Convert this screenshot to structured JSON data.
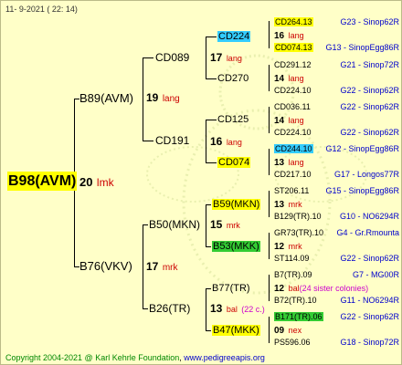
{
  "header": {
    "date": "11-  9-2021 (  22:  14)"
  },
  "footer": {
    "copyright": "Copyright 2004-2021 @ Karl Kehrle Foundation",
    "url": "www.pedigreeapis.org"
  },
  "root": {
    "name": "B98(AVM)",
    "gen": "20",
    "suffix": "lmk"
  },
  "gen1": [
    {
      "name": "B89(AVM)",
      "gen": "19",
      "suffix": "lang"
    },
    {
      "name": "B76(VKV)",
      "gen": "17",
      "suffix": "mrk"
    }
  ],
  "gen2": [
    {
      "name": "CD089",
      "gen": "17",
      "suffix": "lang"
    },
    {
      "name": "CD191",
      "gen": "16",
      "suffix": "lang"
    },
    {
      "name": "B50(MKN)",
      "gen": "15",
      "suffix": "mrk"
    },
    {
      "name": "B26(TR)",
      "gen": "13",
      "suffix": "bal",
      "extra": "(22 c.)"
    }
  ],
  "gen3": [
    {
      "name": "CD224"
    },
    {
      "name": "CD270"
    },
    {
      "name": "CD125"
    },
    {
      "name": "CD074"
    },
    {
      "name": "B59(MKN)"
    },
    {
      "name": "B53(MKK)"
    },
    {
      "name": "B77(TR)"
    },
    {
      "name": "B47(MKK)"
    }
  ],
  "gen4": [
    {
      "name": "CD264.13",
      "code": "G23 - Sinop62R",
      "gen": "16",
      "suffix": "lang",
      "mother": "CD074.13",
      "mcode": "G13 - SinopEgg86R"
    },
    {
      "name": "CD291.12",
      "code": "G21 - Sinop72R",
      "gen": "14",
      "suffix": "lang",
      "mother": "CD224.10",
      "mcode": "G22 - Sinop62R"
    },
    {
      "name": "CD036.11",
      "code": "G22 - Sinop62R",
      "gen": "14",
      "suffix": "lang",
      "mother": "CD224.10",
      "mcode": "G22 - Sinop62R"
    },
    {
      "name": "CD244.10",
      "code": "G12 - SinopEgg86R",
      "gen": "13",
      "suffix": "lang",
      "mother": "CD217.10",
      "mcode": "G17 - Longos77R"
    },
    {
      "name": "ST206.11",
      "code": "G15 - SinopEgg86R",
      "gen": "13",
      "suffix": "mrk",
      "mother": "B129(TR).10",
      "mcode": "G10 - NO6294R"
    },
    {
      "name": "GR73(TR).10",
      "code": "G4 - Gr.Rmounta",
      "gen": "12",
      "suffix": "mrk",
      "mother": "ST114.09",
      "mcode": "G22 - Sinop62R"
    },
    {
      "name": "B7(TR).09",
      "code": "G7 - MG00R",
      "gen": "12",
      "suffix": "bal",
      "extra": "(24 sister colonies)",
      "mother": "B72(TR).10",
      "mcode": "G11 - NO6294R"
    },
    {
      "name": "B171(TR).06",
      "code": "G22 - Sinop62R",
      "gen": "09",
      "suffix": "nex",
      "mother": "PS596.06",
      "mcode": "G18 - Sinop72R"
    }
  ],
  "colors": {
    "background": "#ffffc8",
    "highlight_yellow": "#ffff00",
    "highlight_cyan": "#33ccff",
    "highlight_green": "#33cc33",
    "suffix_red": "#cc0000",
    "code_blue": "#0000cc",
    "footer_green": "#008800"
  }
}
